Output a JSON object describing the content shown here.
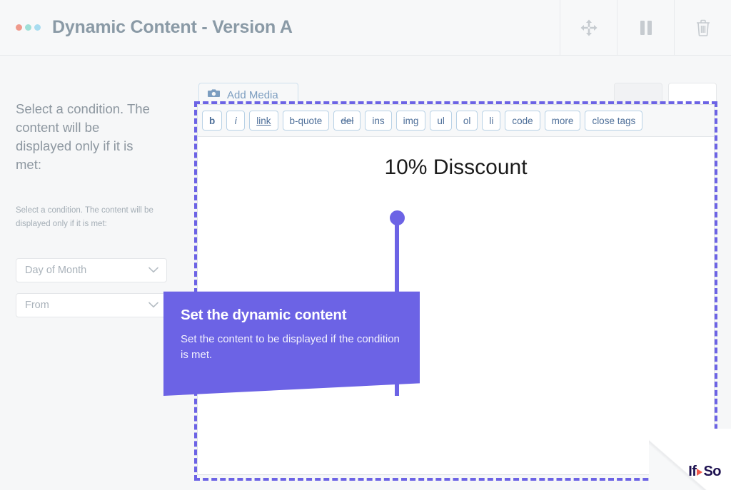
{
  "header": {
    "title": "Dynamic Content - Version A",
    "dots": [
      "salmon-dot",
      "teal-dot",
      "blue-dot"
    ],
    "dot_colors": [
      "#ef9a8c",
      "#9fdfd7",
      "#a8dcf0"
    ],
    "actions": [
      {
        "name": "move-icon",
        "label": "Move"
      },
      {
        "name": "pause-icon",
        "label": "Pause"
      },
      {
        "name": "trash-icon",
        "label": "Delete"
      }
    ]
  },
  "sidebar": {
    "heading": "Select a condition. The content will be displayed only if it is met:",
    "subheading": "Select a condition. The content will be displayed only if it is met:",
    "selects": [
      {
        "name": "condition-type-select",
        "value": "Day of Month",
        "placeholder": "Day of Month"
      },
      {
        "name": "condition-operator-select",
        "value": "From",
        "placeholder": "From"
      }
    ]
  },
  "editor": {
    "add_media_label": "Add Media",
    "tabs": [
      {
        "label": "",
        "name": "tab-visual",
        "active": false
      },
      {
        "label": "",
        "name": "tab-text",
        "active": true
      }
    ],
    "toolbar": [
      {
        "label": "b",
        "style": "bold"
      },
      {
        "label": "i",
        "style": "ital"
      },
      {
        "label": "link",
        "style": "undr"
      },
      {
        "label": "b-quote",
        "style": ""
      },
      {
        "label": "del",
        "style": "strk"
      },
      {
        "label": "ins",
        "style": ""
      },
      {
        "label": "img",
        "style": ""
      },
      {
        "label": "ul",
        "style": ""
      },
      {
        "label": "ol",
        "style": ""
      },
      {
        "label": "li",
        "style": ""
      },
      {
        "label": "code",
        "style": ""
      },
      {
        "label": "more",
        "style": ""
      },
      {
        "label": "close tags",
        "style": ""
      }
    ],
    "content": "10% Disscount",
    "selection_color": "#6c63e5"
  },
  "tooltip": {
    "title": "Set the dynamic content",
    "body": "Set the content to be displayed if the condition is met.",
    "accent": "#6c63e5"
  },
  "branding": {
    "logo_left": "If",
    "logo_right": "So",
    "logo_arrow": "play-triangle-icon",
    "logo_color": "#1d1150",
    "arrow_color": "#f1594c"
  }
}
